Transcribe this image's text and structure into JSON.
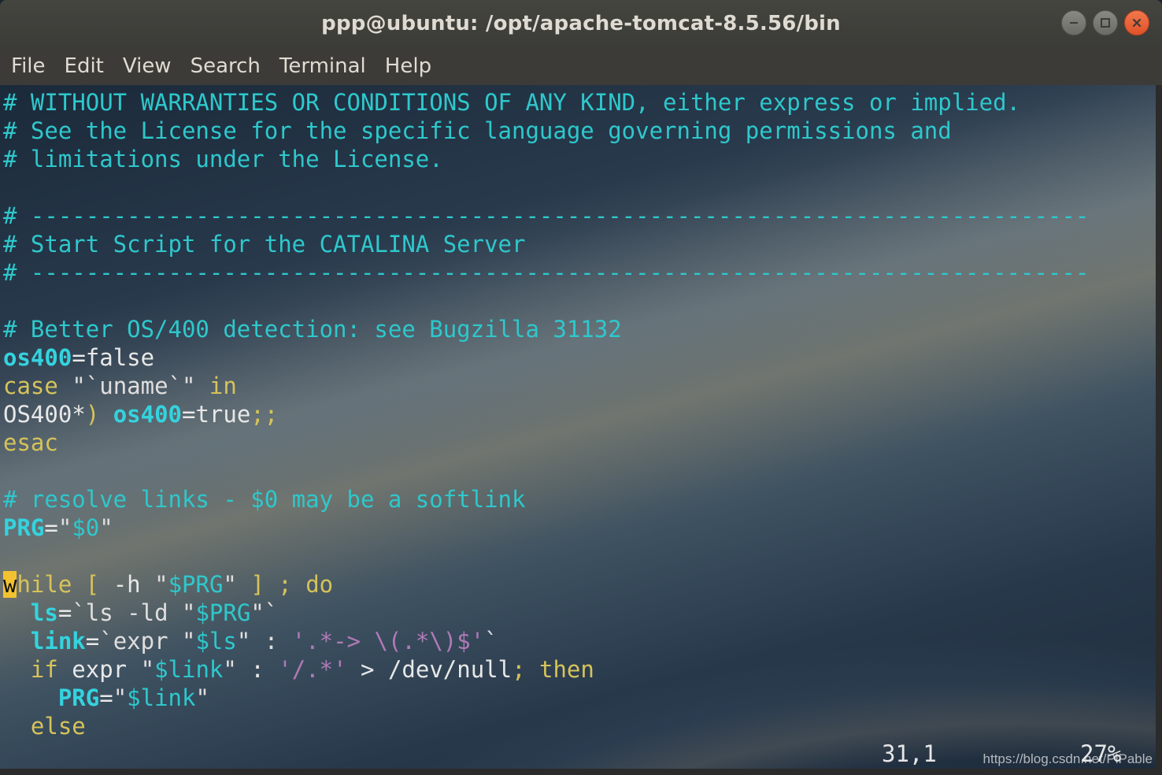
{
  "window": {
    "title": "ppp@ubuntu: /opt/apache-tomcat-8.5.56/bin",
    "controls": {
      "minimize_icon": "minimize-icon",
      "maximize_icon": "maximize-icon",
      "close_icon": "close-icon"
    }
  },
  "menubar": {
    "items": [
      "File",
      "Edit",
      "View",
      "Search",
      "Terminal",
      "Help"
    ]
  },
  "editor": {
    "lines": [
      [
        [
          "c",
          "# WITHOUT WARRANTIES OR CONDITIONS OF ANY KIND, either express or implied."
        ]
      ],
      [
        [
          "c",
          "# See the License for the specific language governing permissions and"
        ]
      ],
      [
        [
          "c",
          "# limitations under the License."
        ]
      ],
      [],
      [
        [
          "c",
          "# -----------------------------------------------------------------------------"
        ]
      ],
      [
        [
          "c",
          "# Start Script for the CATALINA Server"
        ]
      ],
      [
        [
          "c",
          "# -----------------------------------------------------------------------------"
        ]
      ],
      [],
      [
        [
          "c",
          "# Better OS/400 detection: see Bugzilla 31132"
        ]
      ],
      [
        [
          "v",
          "os400"
        ],
        [
          "w",
          "=false"
        ]
      ],
      [
        [
          "k",
          "case"
        ],
        [
          "w",
          " "
        ],
        [
          "s",
          "\"`uname`\""
        ],
        [
          "w",
          " "
        ],
        [
          "k",
          "in"
        ]
      ],
      [
        [
          "w",
          "OS400*"
        ],
        [
          "k",
          ")"
        ],
        [
          "w",
          " "
        ],
        [
          "v",
          "os400"
        ],
        [
          "w",
          "=true"
        ],
        [
          "k",
          ";;"
        ]
      ],
      [
        [
          "k",
          "esac"
        ]
      ],
      [],
      [
        [
          "c",
          "# resolve links - $0 may be a softlink"
        ]
      ],
      [
        [
          "v",
          "PRG"
        ],
        [
          "w",
          "="
        ],
        [
          "s",
          "\""
        ],
        [
          "c",
          "$0"
        ],
        [
          "s",
          "\""
        ]
      ],
      [],
      [
        [
          "cursor",
          "w"
        ],
        [
          "k",
          "hile"
        ],
        [
          "w",
          " "
        ],
        [
          "k",
          "["
        ],
        [
          "w",
          " -h "
        ],
        [
          "s",
          "\""
        ],
        [
          "c",
          "$PRG"
        ],
        [
          "s",
          "\""
        ],
        [
          "w",
          " "
        ],
        [
          "k",
          "]"
        ],
        [
          "w",
          " "
        ],
        [
          "k",
          ";"
        ],
        [
          "w",
          " "
        ],
        [
          "k",
          "do"
        ]
      ],
      [
        [
          "w",
          "  "
        ],
        [
          "v",
          "ls"
        ],
        [
          "w",
          "="
        ],
        [
          "s",
          "`ls -ld "
        ],
        [
          "s",
          "\""
        ],
        [
          "c",
          "$PRG"
        ],
        [
          "s",
          "\""
        ],
        [
          "s",
          "`"
        ]
      ],
      [
        [
          "w",
          "  "
        ],
        [
          "v",
          "link"
        ],
        [
          "w",
          "="
        ],
        [
          "s",
          "`expr "
        ],
        [
          "s",
          "\""
        ],
        [
          "c",
          "$ls"
        ],
        [
          "s",
          "\""
        ],
        [
          "s",
          " : "
        ],
        [
          "p",
          "'.*-> \\(.*\\)$'"
        ],
        [
          "s",
          "`"
        ]
      ],
      [
        [
          "w",
          "  "
        ],
        [
          "k",
          "if"
        ],
        [
          "w",
          " expr "
        ],
        [
          "s",
          "\""
        ],
        [
          "c",
          "$link"
        ],
        [
          "s",
          "\""
        ],
        [
          "w",
          " : "
        ],
        [
          "p",
          "'/.*'"
        ],
        [
          "w",
          " > /dev/null"
        ],
        [
          "k",
          ";"
        ],
        [
          "w",
          " "
        ],
        [
          "k",
          "then"
        ]
      ],
      [
        [
          "w",
          "    "
        ],
        [
          "v",
          "PRG"
        ],
        [
          "w",
          "="
        ],
        [
          "s",
          "\""
        ],
        [
          "c",
          "$link"
        ],
        [
          "s",
          "\""
        ]
      ],
      [
        [
          "w",
          "  "
        ],
        [
          "k",
          "else"
        ]
      ]
    ],
    "status_position": "31,1",
    "status_percent": "27%"
  },
  "watermark": "https://blog.csdn.net/PiPable"
}
